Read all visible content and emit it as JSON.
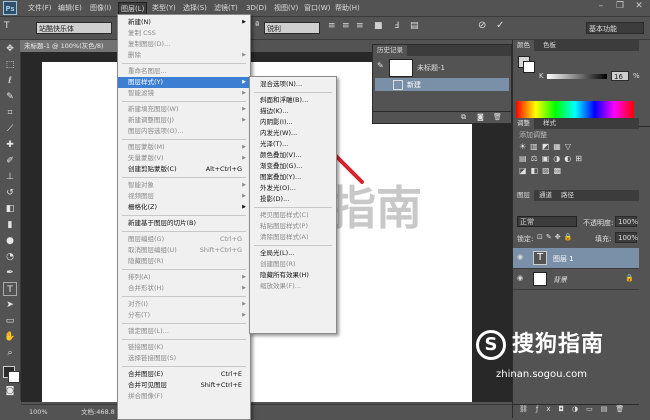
{
  "menubar": {
    "logo": "Ps",
    "items": [
      "文件(F)",
      "编辑(E)",
      "图像(I)",
      "图层(L)",
      "类型(Y)",
      "选择(S)",
      "滤镜(T)",
      "3D(D)",
      "视图(V)",
      "窗口(W)",
      "帮助(H)"
    ],
    "active_index": 3
  },
  "options": {
    "font_family": "站酷快乐体",
    "antialias": "锐利",
    "workspace": "基本功能"
  },
  "document": {
    "tab_label": "未标题-1 @ 100%(灰色/8)",
    "zoom": "100%",
    "doc_info": "文档:468.8"
  },
  "layer_menu": [
    {
      "label": "新建(N)",
      "arrow": true,
      "disabled": false
    },
    {
      "label": "复制 CSS",
      "disabled": true
    },
    {
      "label": "复制图层(D)...",
      "disabled": true
    },
    {
      "label": "删除",
      "arrow": true,
      "disabled": true
    },
    {
      "sep": true
    },
    {
      "label": "重命名图层...",
      "disabled": true
    },
    {
      "label": "图层样式(Y)",
      "arrow": true,
      "highlight": true
    },
    {
      "label": "智能滤镜",
      "arrow": true,
      "disabled": true
    },
    {
      "sep": true
    },
    {
      "label": "新建填充图层(W)",
      "arrow": true,
      "disabled": true
    },
    {
      "label": "新建调整图层(J)",
      "arrow": true,
      "disabled": true
    },
    {
      "label": "图层内容选项(O)...",
      "disabled": true
    },
    {
      "sep": true
    },
    {
      "label": "图层蒙版(M)",
      "arrow": true,
      "disabled": true
    },
    {
      "label": "矢量蒙版(V)",
      "arrow": true,
      "disabled": true
    },
    {
      "label": "创建剪贴蒙版(C)",
      "shortcut": "Alt+Ctrl+G"
    },
    {
      "sep": true
    },
    {
      "label": "智能对象",
      "arrow": true,
      "disabled": true
    },
    {
      "label": "视频图层",
      "arrow": true,
      "disabled": true
    },
    {
      "label": "栅格化(Z)",
      "arrow": true
    },
    {
      "sep": true
    },
    {
      "label": "新建基于图层的切片(B)"
    },
    {
      "sep": true
    },
    {
      "label": "图层编组(G)",
      "shortcut": "Ctrl+G",
      "disabled": true
    },
    {
      "label": "取消图层编组(U)",
      "shortcut": "Shift+Ctrl+G",
      "disabled": true
    },
    {
      "label": "隐藏图层(R)",
      "disabled": true
    },
    {
      "sep": true
    },
    {
      "label": "排列(A)",
      "arrow": true,
      "disabled": true
    },
    {
      "label": "合并形状(H)",
      "arrow": true,
      "disabled": true
    },
    {
      "sep": true
    },
    {
      "label": "对齐(I)",
      "arrow": true,
      "disabled": true
    },
    {
      "label": "分布(T)",
      "arrow": true,
      "disabled": true
    },
    {
      "sep": true
    },
    {
      "label": "锁定图层(L)...",
      "disabled": true
    },
    {
      "sep": true
    },
    {
      "label": "链接图层(K)",
      "disabled": true
    },
    {
      "label": "选择链接图层(S)",
      "disabled": true
    },
    {
      "sep": true
    },
    {
      "label": "合并图层(E)",
      "shortcut": "Ctrl+E"
    },
    {
      "label": "合并可见图层",
      "shortcut": "Shift+Ctrl+E"
    },
    {
      "label": "拼合图像(F)",
      "disabled": true
    }
  ],
  "style_menu": [
    {
      "label": "混合选项(N)..."
    },
    {
      "sep": true
    },
    {
      "label": "斜面和浮雕(B)..."
    },
    {
      "label": "描边(K)..."
    },
    {
      "label": "内阴影(I)..."
    },
    {
      "label": "内发光(W)..."
    },
    {
      "label": "光泽(T)..."
    },
    {
      "label": "颜色叠加(V)..."
    },
    {
      "label": "渐变叠加(G)..."
    },
    {
      "label": "图案叠加(Y)..."
    },
    {
      "label": "外发光(O)..."
    },
    {
      "label": "投影(D)..."
    },
    {
      "sep": true
    },
    {
      "label": "拷贝图层样式(C)",
      "disabled": true
    },
    {
      "label": "粘贴图层样式(P)",
      "disabled": true
    },
    {
      "label": "清除图层样式(A)",
      "disabled": true
    },
    {
      "sep": true
    },
    {
      "label": "全局光(L)..."
    },
    {
      "label": "创建图层(R)",
      "disabled": true
    },
    {
      "label": "隐藏所有效果(H)"
    },
    {
      "label": "缩放效果(F)...",
      "disabled": true
    }
  ],
  "history": {
    "tab": "历史记录",
    "doc_name": "未标题-1",
    "step": "新建"
  },
  "color_panel": {
    "tabs": [
      "颜色",
      "色板"
    ],
    "k_label": "K",
    "k_value": "16",
    "k_unit": "%"
  },
  "adjust_panel": {
    "tabs": [
      "调整",
      "样式"
    ],
    "hint": "添加调整"
  },
  "layers_panel": {
    "tabs": [
      "图层",
      "通道",
      "路径"
    ],
    "blend_mode": "正常",
    "opacity_label": "不透明度:",
    "opacity": "100%",
    "lock_label": "锁定:",
    "fill_label": "填充:",
    "fill": "100%",
    "layers": [
      {
        "name": "图层 1",
        "type": "text",
        "selected": true
      },
      {
        "name": "背景",
        "type": "background",
        "selected": false
      }
    ]
  },
  "watermark": {
    "big_text": "指南",
    "brand_letter": "S",
    "brand": "搜狗指南",
    "url": "zhinan.sogou.com"
  },
  "colors": {
    "ui_bg": "#535353",
    "highlight": "#3c7fd2",
    "arrow_red": "#d8232a"
  }
}
